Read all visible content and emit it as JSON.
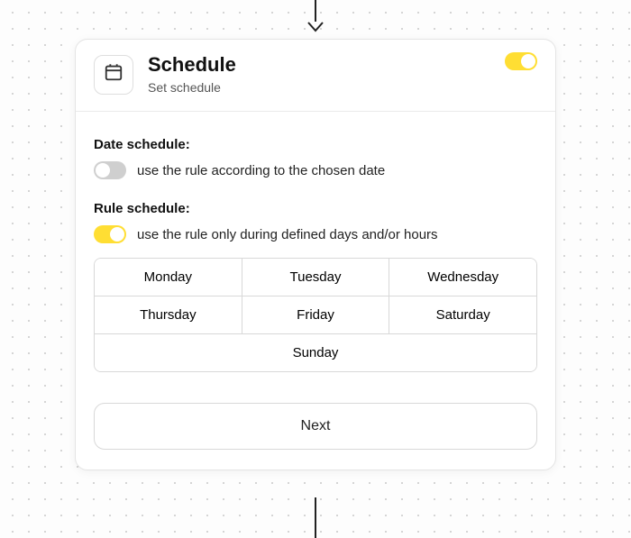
{
  "header": {
    "title": "Schedule",
    "subtitle": "Set schedule",
    "main_toggle": true
  },
  "date_schedule": {
    "label": "Date schedule:",
    "toggle": false,
    "desc": "use the rule according to the chosen date"
  },
  "rule_schedule": {
    "label": "Rule schedule:",
    "toggle": true,
    "desc": "use the rule only during defined days and/or hours"
  },
  "days": {
    "monday": "Monday",
    "tuesday": "Tuesday",
    "wednesday": "Wednesday",
    "thursday": "Thursday",
    "friday": "Friday",
    "saturday": "Saturday",
    "sunday": "Sunday"
  },
  "next_button": "Next",
  "colors": {
    "accent": "#ffde33",
    "toggle_off": "#cfcfcf"
  }
}
